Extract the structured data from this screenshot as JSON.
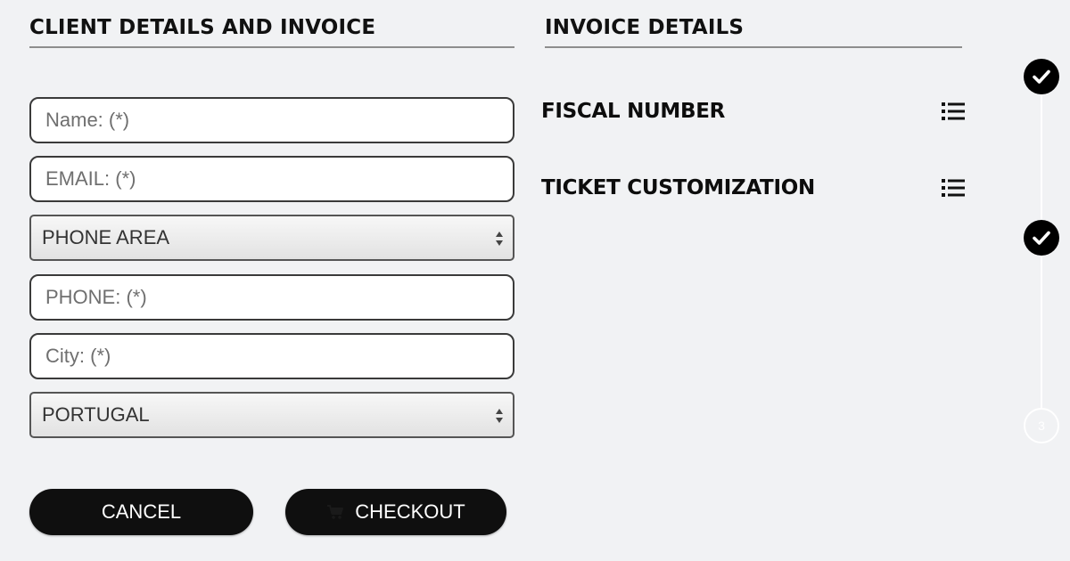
{
  "client_section": {
    "title": "CLIENT DETAILS AND INVOICE",
    "fields": {
      "name": {
        "placeholder": "Name: (*)",
        "value": ""
      },
      "email": {
        "placeholder": "EMAIL: (*)",
        "value": ""
      },
      "phone_area": {
        "selected": "PHONE AREA"
      },
      "phone": {
        "placeholder": "PHONE: (*)",
        "value": ""
      },
      "city": {
        "placeholder": "City: (*)",
        "value": ""
      },
      "country": {
        "selected": "PORTUGAL"
      }
    },
    "buttons": {
      "cancel": "CANCEL",
      "checkout": "CHECKOUT"
    }
  },
  "invoice_section": {
    "title": "INVOICE DETAILS",
    "rows": [
      {
        "label": "FISCAL NUMBER",
        "icon": "list-icon"
      },
      {
        "label": "TICKET CUSTOMIZATION",
        "icon": "list-icon"
      }
    ]
  },
  "stepper": {
    "steps": [
      {
        "state": "complete",
        "icon": "checkmark-icon"
      },
      {
        "state": "complete",
        "icon": "checkmark-icon"
      },
      {
        "state": "pending",
        "number": "3"
      }
    ]
  },
  "colors": {
    "background": "#f1f2f4",
    "button": "#0f0f0f",
    "step_complete": "#000000",
    "step_pending": "#ffffff"
  }
}
